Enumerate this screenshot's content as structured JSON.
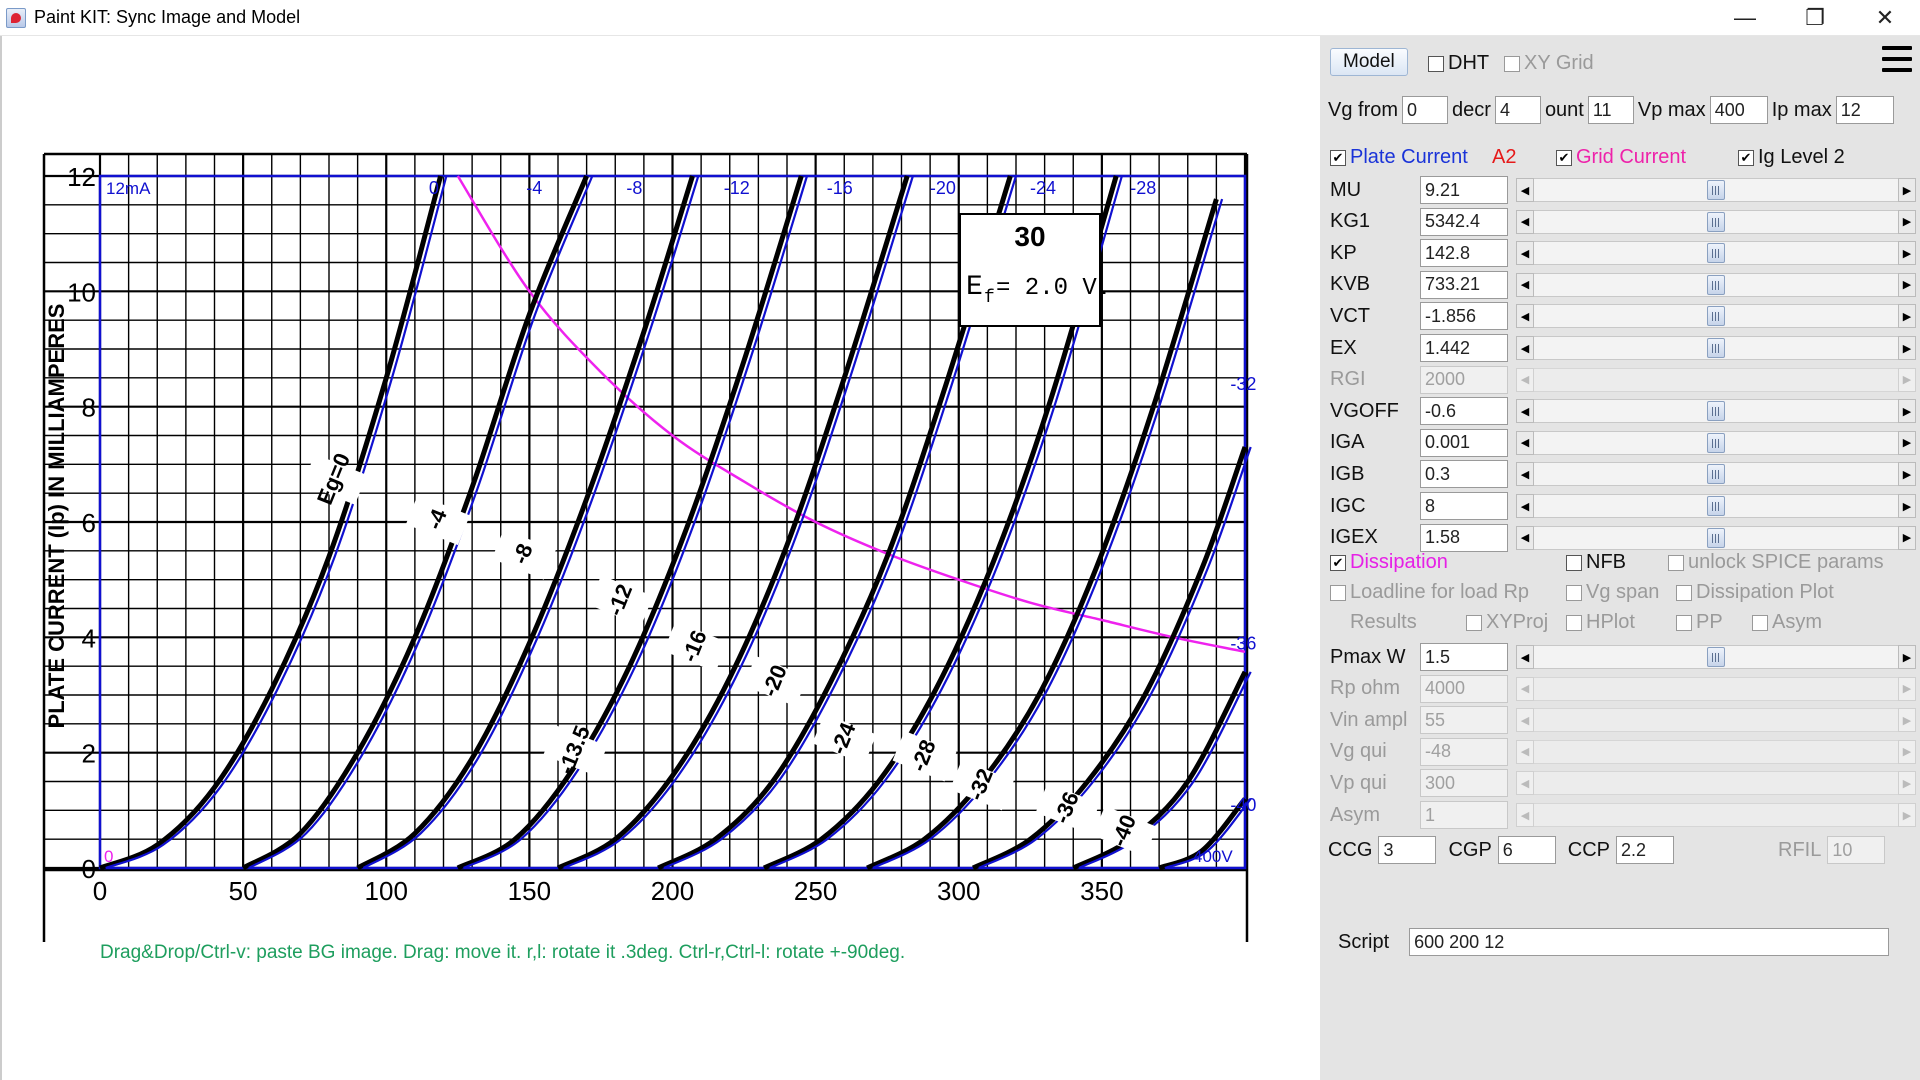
{
  "window": {
    "title": "Paint KIT: Sync Image and Model",
    "minimize": "—",
    "maximize": "❐",
    "close": "✕"
  },
  "canvas": {
    "hint": "Drag&Drop/Ctrl-v: paste BG image. Drag: move it. r,l: rotate it .3deg. Ctrl-r,Ctrl-l: rotate +-90deg.",
    "y_axis_title": "PLATE CURRENT (Ip) IN MILLIAMPERES",
    "plot_label_ip": "12mA",
    "plot_label_vp": "400V",
    "plot_label_zero": "0",
    "tube_type": "30",
    "filament": "E",
    "filament_sub": "f",
    "filament_value": "= 2.0 V."
  },
  "chart_data": {
    "type": "line",
    "xlabel": "",
    "ylabel": "PLATE CURRENT (Ip) IN MILLIAMPERES",
    "xlim": [
      0,
      400
    ],
    "ylim": [
      0,
      12
    ],
    "x_ticks": [
      "0",
      "50",
      "100",
      "150",
      "200",
      "250",
      "300",
      "350"
    ],
    "y_ticks": [
      "0",
      "2",
      "4",
      "6",
      "8",
      "10",
      "12"
    ],
    "grid": true,
    "curve_labels_top": [
      "0",
      "-4",
      "-8",
      "-12",
      "-16",
      "-20",
      "-24",
      "-28",
      "-32",
      "-36",
      "-40"
    ],
    "datasheet_labels": [
      "Eg=0",
      "-4",
      "-8",
      "-12",
      "-13.5",
      "-16",
      "-20",
      "-24",
      "-28",
      "-32",
      "-36",
      "-40"
    ],
    "series": [
      {
        "name": "0",
        "x": [
          0,
          20,
          40,
          60,
          80,
          100,
          119
        ],
        "y": [
          0,
          0.4,
          1.4,
          3.1,
          5.4,
          8.5,
          12
        ]
      },
      {
        "name": "-4",
        "x": [
          50,
          70,
          90,
          110,
          130,
          150,
          170
        ],
        "y": [
          0,
          0.6,
          2.0,
          4.0,
          6.6,
          9.6,
          12
        ]
      },
      {
        "name": "-8",
        "x": [
          90,
          110,
          130,
          150,
          170,
          190,
          207
        ],
        "y": [
          0,
          0.6,
          1.9,
          3.9,
          6.4,
          9.3,
          12
        ]
      },
      {
        "name": "-12",
        "x": [
          125,
          145,
          165,
          185,
          205,
          225,
          245
        ],
        "y": [
          0,
          0.5,
          1.7,
          3.5,
          5.9,
          8.8,
          12
        ]
      },
      {
        "name": "-16",
        "x": [
          160,
          180,
          200,
          220,
          240,
          260,
          282
        ],
        "y": [
          0,
          0.5,
          1.6,
          3.3,
          5.6,
          8.5,
          12
        ]
      },
      {
        "name": "-20",
        "x": [
          195,
          215,
          235,
          255,
          275,
          295,
          318
        ],
        "y": [
          0,
          0.5,
          1.5,
          3.2,
          5.4,
          8.3,
          12
        ]
      },
      {
        "name": "-24",
        "x": [
          232,
          252,
          272,
          292,
          312,
          332,
          355
        ],
        "y": [
          0,
          0.5,
          1.5,
          3.1,
          5.3,
          8.1,
          12
        ]
      },
      {
        "name": "-28",
        "x": [
          268,
          288,
          308,
          328,
          348,
          368,
          390
        ],
        "y": [
          0,
          0.5,
          1.5,
          3.0,
          5.2,
          8.0,
          11.6
        ]
      },
      {
        "name": "-32",
        "x": [
          305,
          325,
          345,
          365,
          385,
          400
        ],
        "y": [
          0,
          0.5,
          1.5,
          3.0,
          5.2,
          7.3
        ]
      },
      {
        "name": "-36",
        "x": [
          340,
          360,
          380,
          400
        ],
        "y": [
          0,
          0.5,
          1.5,
          3.4
        ]
      },
      {
        "name": "-40",
        "x": [
          370,
          385,
          400
        ],
        "y": [
          0,
          0.3,
          1.2
        ]
      }
    ],
    "dissipation": {
      "name": "Dissipation",
      "x": [
        125,
        150,
        175,
        200,
        225,
        250,
        275,
        300,
        325,
        350,
        375,
        400
      ],
      "y": [
        12,
        10,
        8.6,
        7.5,
        6.7,
        6.0,
        5.45,
        5.0,
        4.6,
        4.3,
        4.0,
        3.75
      ]
    },
    "colors": {
      "model": "#1010d0",
      "datasheet": "#000000",
      "dissipation": "#ee22ee"
    }
  },
  "panel": {
    "model_button": "Model",
    "dht_label": "DHT",
    "xy_grid_label": "XY Grid",
    "menu_icon": "hamburger-menu-icon",
    "vg_from_label": "Vg from",
    "vg_from_value": "0",
    "decr_label": "decr",
    "decr_value": "4",
    "count_label": "ount",
    "count_value": "11",
    "vp_max_label": "Vp max",
    "vp_max_value": "400",
    "ip_max_label": "Ip max",
    "ip_max_value": "12",
    "plate_current_label": "Plate Current",
    "a2_label": "A2",
    "grid_current_label": "Grid Current",
    "ig_level_label": "Ig Level 2",
    "params": [
      {
        "label": "MU",
        "value": "9.21",
        "enabled": true
      },
      {
        "label": "KG1",
        "value": "5342.4",
        "enabled": true
      },
      {
        "label": "KP",
        "value": "142.8",
        "enabled": true
      },
      {
        "label": "KVB",
        "value": "733.21",
        "enabled": true
      },
      {
        "label": "VCT",
        "value": "-1.856",
        "enabled": true
      },
      {
        "label": "EX",
        "value": "1.442",
        "enabled": true
      },
      {
        "label": "RGI",
        "value": "2000",
        "enabled": false
      },
      {
        "label": "VGOFF",
        "value": "-0.6",
        "enabled": true
      },
      {
        "label": "IGA",
        "value": "0.001",
        "enabled": true
      },
      {
        "label": "IGB",
        "value": "0.3",
        "enabled": true
      },
      {
        "label": "IGC",
        "value": "8",
        "enabled": true
      },
      {
        "label": "IGEX",
        "value": "1.58",
        "enabled": true
      }
    ],
    "dissipation_label": "Dissipation",
    "nfb_label": "NFB",
    "unlock_label": "unlock SPICE params",
    "loadline_label": "Loadline for load Rp",
    "vg_span_label": "Vg span",
    "dissipation_plot_label": "Dissipation Plot",
    "results_label": "Results",
    "xyproj_label": "XYProj",
    "hplot_label": "HPlot",
    "pp_label": "PP",
    "asym_cb_label": "Asym",
    "params2": [
      {
        "label": "Pmax W",
        "value": "1.5",
        "enabled": true
      },
      {
        "label": "Rp ohm",
        "value": "4000",
        "enabled": false
      },
      {
        "label": "Vin ampl",
        "value": "55",
        "enabled": false
      },
      {
        "label": "Vg qui",
        "value": "-48",
        "enabled": false
      },
      {
        "label": "Vp qui",
        "value": "300",
        "enabled": false
      },
      {
        "label": "Asym",
        "value": "1",
        "enabled": false
      }
    ],
    "ccg_label": "CCG",
    "ccg_value": "3",
    "cgp_label": "CGP",
    "cgp_value": "6",
    "ccp_label": "CCP",
    "ccp_value": "2.2",
    "rfil_label": "RFIL",
    "rfil_value": "10",
    "script_label": "Script",
    "script_value": "600 200 12"
  }
}
